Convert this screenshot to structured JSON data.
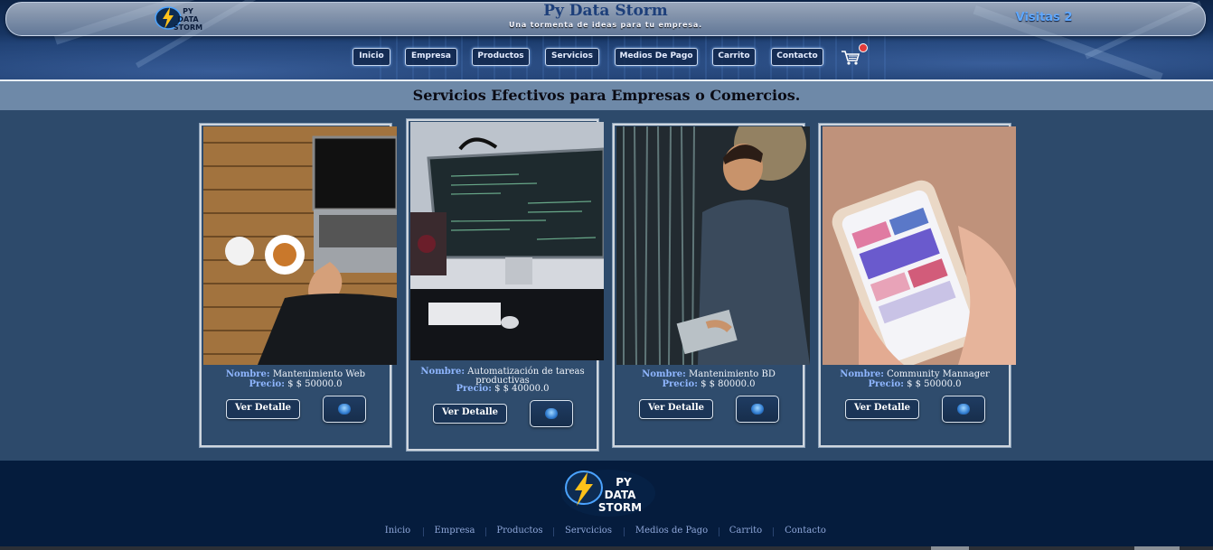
{
  "header": {
    "site_title": "Py Data Storm",
    "tagline": "Una tormenta de ideas para tu empresa.",
    "visits": "Visitas 2",
    "logo_text": [
      "PY",
      "DATA",
      "STORM"
    ]
  },
  "nav": {
    "items": [
      "Inicio",
      "Empresa",
      "Productos",
      "Servicios",
      "Medios De Pago",
      "Carrito",
      "Contacto"
    ],
    "cart_icon": "cart-icon",
    "cart_badge_color": "#e23b3b"
  },
  "section": {
    "title": "Servicios Efectivos para Empresas o Comercios."
  },
  "cards": [
    {
      "name_label": "Nombre:",
      "name": "Mantenimiento Web",
      "price_label": "Precio:",
      "price": "$ $ 50000.0",
      "detail_label": "Ver Detalle",
      "image": "laptop-on-wooden-table"
    },
    {
      "name_label": "Nombre:",
      "name": "Automatización de tareas productivas",
      "price_label": "Precio:",
      "price": "$ $ 40000.0",
      "detail_label": "Ver Detalle",
      "image": "desk-monitor-with-code"
    },
    {
      "name_label": "Nombre:",
      "name": "Mantenimiento BD",
      "price_label": "Precio:",
      "price": "$ $ 80000.0",
      "detail_label": "Ver Detalle",
      "image": "technician-in-server-room"
    },
    {
      "name_label": "Nombre:",
      "name": "Community Mannager",
      "price_label": "Precio:",
      "price": "$ $ 50000.0",
      "detail_label": "Ver Detalle",
      "image": "hand-holding-smartphone"
    }
  ],
  "footer": {
    "logo_text": [
      "PY",
      "DATA",
      "STORM"
    ],
    "links": [
      "Inicio",
      "Empresa",
      "Productos",
      "Servcicios",
      "Medios de Pago",
      "Carrito",
      "Contacto"
    ]
  },
  "colors": {
    "page_bg": "#2d4a6b",
    "section_band": "#6e89a8",
    "footer_bg": "#051c3d",
    "accent_label": "#8fb6ff",
    "visits": "#5fa8ff"
  }
}
